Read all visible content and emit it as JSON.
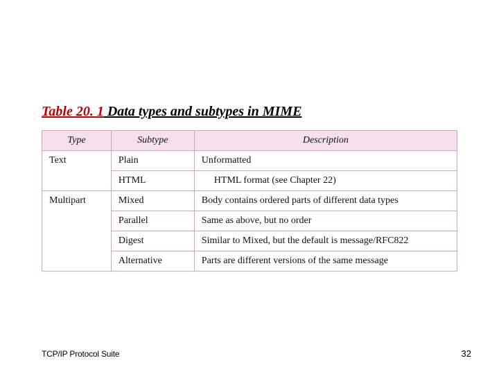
{
  "caption": {
    "number": "Table 20. 1",
    "title": "  Data types and subtypes in MIME"
  },
  "table": {
    "headers": {
      "type": "Type",
      "subtype": "Subtype",
      "description": "Description"
    },
    "groups": [
      {
        "type": "Text",
        "rows": [
          {
            "subtype": "Plain",
            "description": "Unformatted",
            "indent": false
          },
          {
            "subtype": "HTML",
            "description": "HTML format (see Chapter 22)",
            "indent": true
          }
        ]
      },
      {
        "type": "Multipart",
        "rows": [
          {
            "subtype": "Mixed",
            "description": "Body contains ordered parts of different data types",
            "indent": false
          },
          {
            "subtype": "Parallel",
            "description": "Same as above, but no order",
            "indent": false
          },
          {
            "subtype": "Digest",
            "description": "Similar to Mixed, but the default is message/RFC822",
            "indent": false
          },
          {
            "subtype": "Alternative",
            "description": "Parts are different versions of the same message",
            "indent": false
          }
        ]
      }
    ]
  },
  "footer": {
    "left": "TCP/IP Protocol Suite",
    "right": "32"
  }
}
